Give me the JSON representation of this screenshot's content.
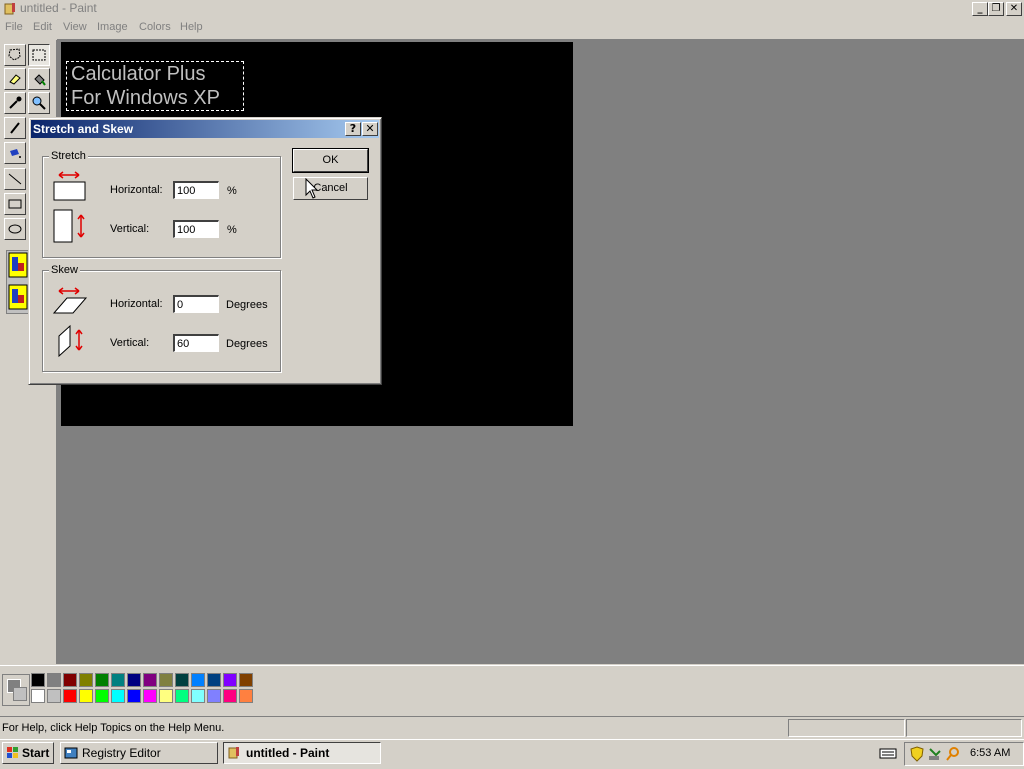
{
  "window": {
    "title": "untitled - Paint"
  },
  "menu": [
    "File",
    "Edit",
    "View",
    "Image",
    "Colors",
    "Help"
  ],
  "canvas": {
    "text_line1": "Calculator Plus",
    "text_line2": "For Windows XP"
  },
  "dialog": {
    "title": "Stretch and Skew",
    "help_glyph": "?",
    "close_glyph": "✕",
    "stretch": {
      "label": "Stretch",
      "horizontal_label": "Horizontal:",
      "horizontal_value": "100",
      "horizontal_unit": "%",
      "vertical_label": "Vertical:",
      "vertical_value": "100",
      "vertical_unit": "%"
    },
    "skew": {
      "label": "Skew",
      "horizontal_label": "Horizontal:",
      "horizontal_value": "0",
      "horizontal_unit": "Degrees",
      "vertical_label": "Vertical:",
      "vertical_value": "60",
      "vertical_unit": "Degrees"
    },
    "ok_label": "OK",
    "cancel_label": "Cancel"
  },
  "palette": {
    "row1": [
      "#000000",
      "#808080",
      "#800000",
      "#808000",
      "#008000",
      "#008080",
      "#000080",
      "#800080",
      "#808040",
      "#004040",
      "#0080ff",
      "#004080",
      "#8000ff",
      "#804000"
    ],
    "row2": [
      "#ffffff",
      "#c0c0c0",
      "#ff0000",
      "#ffff00",
      "#00ff00",
      "#00ffff",
      "#0000ff",
      "#ff00ff",
      "#ffff80",
      "#00ff80",
      "#80ffff",
      "#8080ff",
      "#ff0080",
      "#ff8040"
    ]
  },
  "statusbar": {
    "help_text": "For Help, click Help Topics on the Help Menu."
  },
  "taskbar": {
    "start_label": "Start",
    "tasks": [
      {
        "label": "Registry Editor"
      },
      {
        "label": "untitled - Paint"
      }
    ],
    "clock": "6:53 AM"
  }
}
